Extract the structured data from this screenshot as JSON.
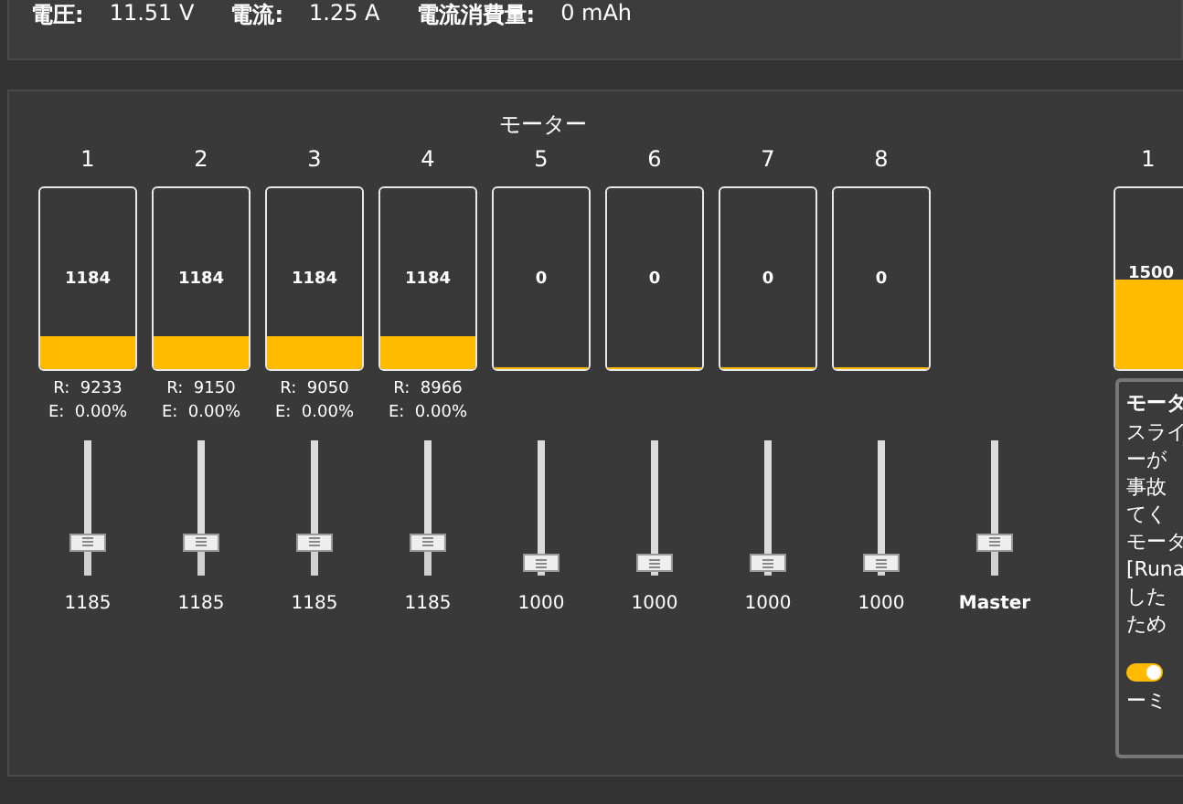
{
  "status_bar": [
    {
      "label": "電圧:",
      "value": "11.51 V"
    },
    {
      "label": "電流:",
      "value": "1.25 A"
    },
    {
      "label": "電流消費量:",
      "value": "0 mAh"
    }
  ],
  "motors": {
    "title": "モーター",
    "items": [
      {
        "number": "1",
        "output": "1184",
        "level": 0.184,
        "rpm": "R:  9233",
        "error": "E:  0.00%"
      },
      {
        "number": "2",
        "output": "1184",
        "level": 0.184,
        "rpm": "R:  9150",
        "error": "E:  0.00%"
      },
      {
        "number": "3",
        "output": "1184",
        "level": 0.184,
        "rpm": "R:  9050",
        "error": "E:  0.00%"
      },
      {
        "number": "4",
        "output": "1184",
        "level": 0.184,
        "rpm": "R:  8966",
        "error": "E:  0.00%"
      },
      {
        "number": "5",
        "output": "0",
        "level": 0
      },
      {
        "number": "6",
        "output": "0",
        "level": 0
      },
      {
        "number": "7",
        "output": "0",
        "level": 0
      },
      {
        "number": "8",
        "output": "0",
        "level": 0
      }
    ],
    "sliders": [
      {
        "value": "1185",
        "level": 0.185
      },
      {
        "value": "1185",
        "level": 0.185
      },
      {
        "value": "1185",
        "level": 0.185
      },
      {
        "value": "1185",
        "level": 0.185
      },
      {
        "value": "1000",
        "level": 0
      },
      {
        "value": "1000",
        "level": 0
      },
      {
        "value": "1000",
        "level": 0
      },
      {
        "value": "1000",
        "level": 0
      }
    ],
    "master": {
      "label": "Master",
      "level": 0.185
    }
  },
  "right_panel": {
    "motor": {
      "number": "1",
      "output": "1500",
      "level": 0.5
    },
    "notice": {
      "title": "モータ",
      "lines": [
        "スライ",
        "ーが",
        "事故",
        "てく",
        "モータ",
        "[Runa",
        "した",
        "ため"
      ],
      "toggle_on": true,
      "toggle_label": "ーミ"
    }
  }
}
